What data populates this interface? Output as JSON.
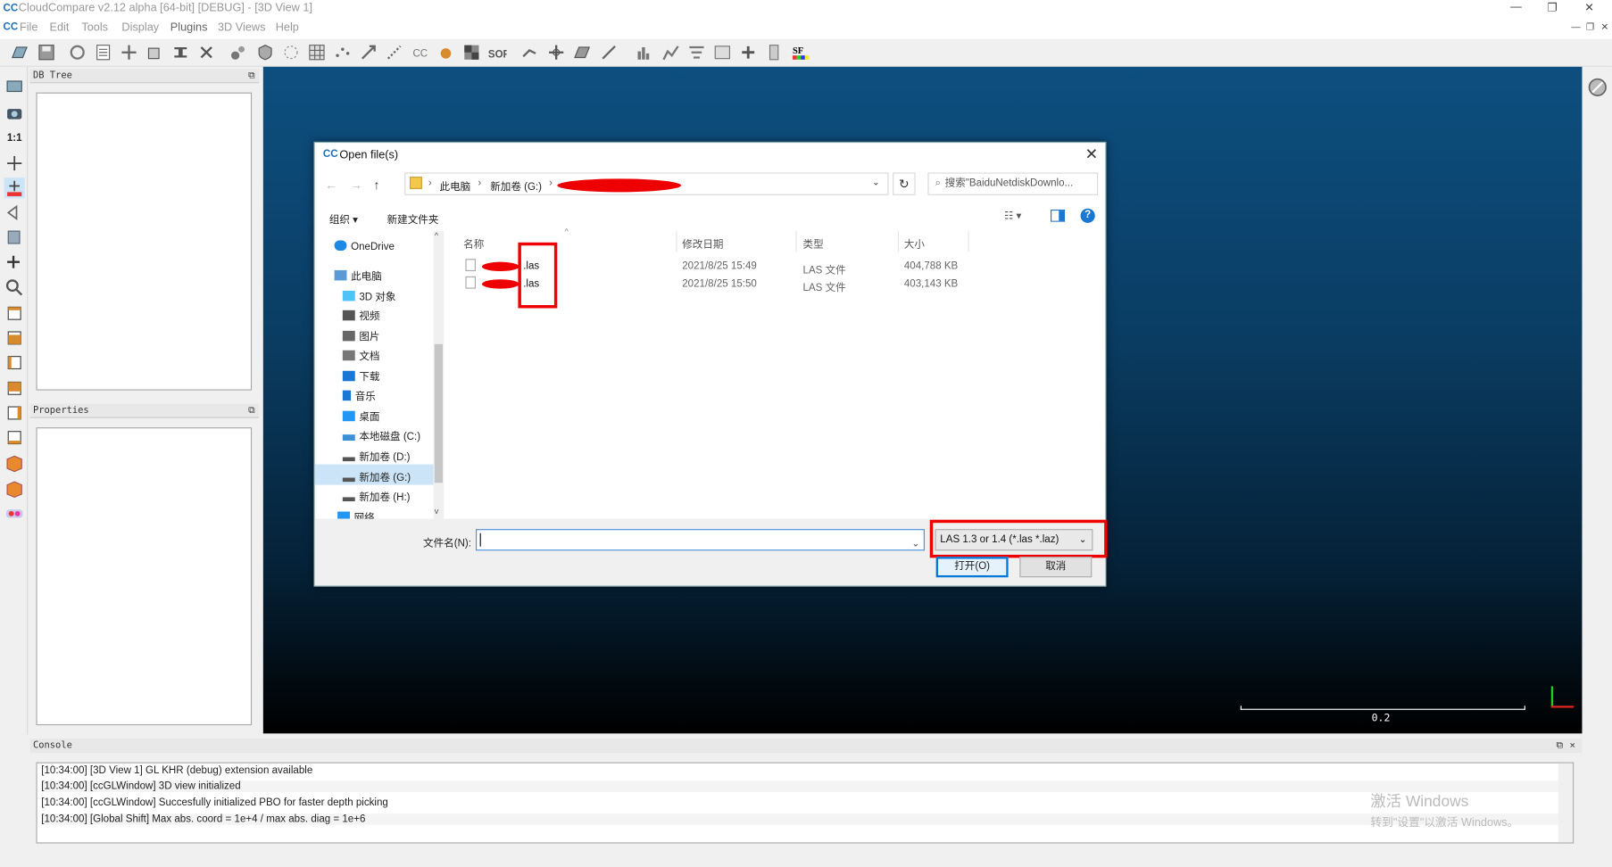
{
  "window": {
    "title": "CloudCompare v2.12 alpha [64-bit] [DEBUG] - [3D View 1]",
    "logo": "CC",
    "controls": [
      "—",
      "❐",
      "✕"
    ]
  },
  "menu": {
    "items": [
      "File",
      "Edit",
      "Tools",
      "Display",
      "Plugins",
      "3D Views",
      "Help"
    ],
    "mdi_controls": [
      "—",
      "❐",
      "✕"
    ]
  },
  "panels": {
    "db_tree": "DB Tree",
    "properties": "Properties",
    "console": "Console",
    "float_icon": "⧉",
    "close_icon": "✕"
  },
  "view3d": {
    "scale_value": "0.2",
    "left_tool_label": "1:1"
  },
  "console": {
    "lines": [
      "[10:34:00] [3D View 1] GL KHR (debug) extension available",
      "[10:34:00] [ccGLWindow] 3D view initialized",
      "[10:34:00] [ccGLWindow] Succesfully initialized PBO for faster depth picking",
      "[10:34:00] [Global Shift] Max abs. coord = 1e+4 / max abs. diag = 1e+6"
    ],
    "watermark_title": "激活 Windows",
    "watermark_text": "转到\"设置\"以激活 Windows。"
  },
  "dialog": {
    "title": "Open file(s)",
    "logo": "CC",
    "close": "✕",
    "breadcrumbs": [
      "此电脑",
      "新加卷 (G:)"
    ],
    "refresh": "↻",
    "search_placeholder": "搜索\"BaiduNetdiskDownlo...",
    "organize": "组织 ▾",
    "new_folder": "新建文件夹",
    "view_icon": "☷ ▾",
    "help": "?",
    "nav": [
      {
        "label": "OneDrive",
        "color": "#1e88e5"
      },
      {
        "label": "此电脑",
        "color": "#5b9bd5"
      },
      {
        "label": "3D 对象",
        "color": "#4fc3f7"
      },
      {
        "label": "视频",
        "color": "#555555"
      },
      {
        "label": "图片",
        "color": "#666666"
      },
      {
        "label": "文档",
        "color": "#777777"
      },
      {
        "label": "下载",
        "color": "#1976d2"
      },
      {
        "label": "音乐",
        "color": "#1976d2"
      },
      {
        "label": "桌面",
        "color": "#2196f3"
      },
      {
        "label": "本地磁盘 (C:)",
        "color": "#3d8fd6"
      },
      {
        "label": "新加卷 (D:)",
        "color": "#555555"
      },
      {
        "label": "新加卷 (G:)",
        "color": "#555555"
      },
      {
        "label": "新加卷 (H:)",
        "color": "#555555"
      },
      {
        "label": "网络",
        "color": "#2196f3"
      }
    ],
    "columns": [
      "名称",
      "修改日期",
      "类型",
      "大小"
    ],
    "files": [
      {
        "name": ".las",
        "date": "2021/8/25 15:49",
        "type": "LAS 文件",
        "size": "404,788 KB"
      },
      {
        "name": ".las",
        "date": "2021/8/25 15:50",
        "type": "LAS 文件",
        "size": "403,143 KB"
      }
    ],
    "filename_label": "文件名(N):",
    "filename_value": "",
    "filter": "LAS 1.3 or 1.4 (*.las *.laz)",
    "open_button": "打开(O)",
    "cancel_button": "取消"
  },
  "colors": {
    "annotation_red": "#e00000",
    "accent_blue": "#0078d7"
  }
}
